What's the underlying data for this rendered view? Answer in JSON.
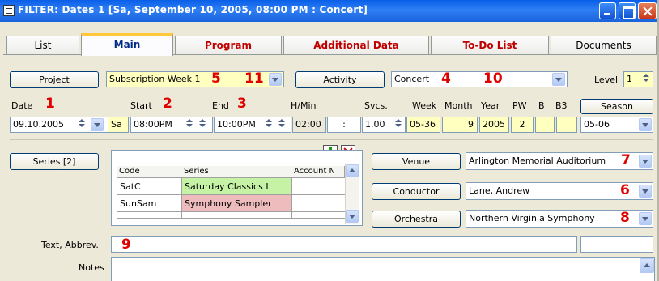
{
  "window": {
    "title": "FILTER: Dates  1 [Sa, September  10, 2005, 08:00 PM :  Concert]"
  },
  "tabs": [
    {
      "label": "List"
    },
    {
      "label": "Main"
    },
    {
      "label": "Program"
    },
    {
      "label": "Additional Data"
    },
    {
      "label": "To-Do List"
    },
    {
      "label": "Documents"
    }
  ],
  "row1": {
    "project_button": "Project",
    "project_value": "Subscription Week 1",
    "activity_button": "Activity",
    "activity_value": "Concert",
    "level_label": "Level",
    "level_value": "1"
  },
  "date_row": {
    "labels": {
      "date": "Date",
      "start": "Start",
      "end": "End",
      "hmin": "H/Min",
      "svcs": "Svcs.",
      "week": "Week",
      "month": "Month",
      "year": "Year",
      "pw": "PW",
      "b": "B",
      "b3": "B3"
    },
    "season_button": "Season",
    "date": "09.10.2005",
    "weekday": "Sa",
    "start": "08:00PM",
    "end": "10:00PM",
    "hmin": "02:00",
    "colon": ":",
    "svcs": "1.00",
    "week": "05-36",
    "month": "9",
    "year": "2005",
    "pw": "2",
    "b": "",
    "b3": "",
    "season": "05-06"
  },
  "series": {
    "button": "Series [2]",
    "columns": [
      "Code",
      "Series",
      "Account N"
    ],
    "rows": [
      {
        "code": "SatC",
        "series": "Saturday Classics I",
        "account": "",
        "color": "#c6f2a6"
      },
      {
        "code": "SunSam",
        "series": "Symphony Sampler",
        "account": "",
        "color": "#eebcbc"
      }
    ]
  },
  "right_panel": {
    "venue_button": "Venue",
    "venue_value": "Arlington Memorial Auditorium",
    "conductor_button": "Conductor",
    "conductor_value": "Lane, Andrew",
    "orchestra_button": "Orchestra",
    "orchestra_value": "Northern Virginia Symphony"
  },
  "text_abbrev": {
    "label": "Text, Abbrev.",
    "value": "",
    "value2": ""
  },
  "notes": {
    "label": "Notes",
    "value": ""
  },
  "callouts": {
    "n1": "1",
    "n2": "2",
    "n3": "3",
    "n4": "4",
    "n5": "5",
    "n6": "6",
    "n7": "7",
    "n8": "8",
    "n9": "9",
    "n10": "10",
    "n11": "11"
  },
  "colors": {
    "callout": "#e00000",
    "title_bar": "#1a63dc",
    "yellow_field": "#ffffc0",
    "active_tab_accent": "#ffc83c",
    "tab_red": "#c00000"
  }
}
